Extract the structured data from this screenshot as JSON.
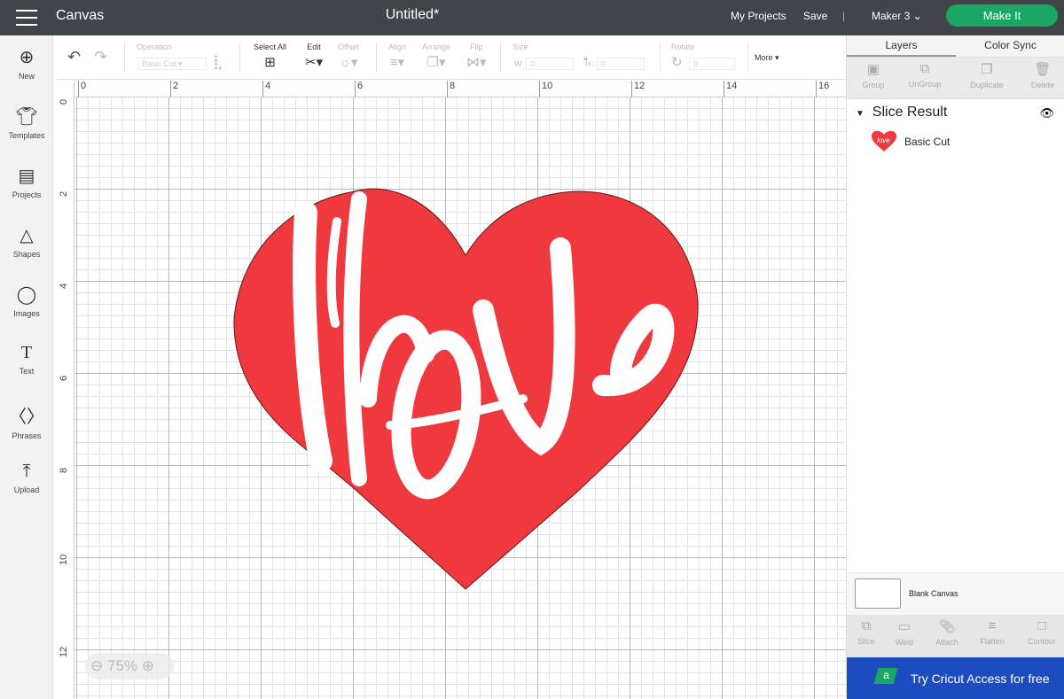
{
  "header": {
    "app_title": "Canvas",
    "doc_title": "Untitled*",
    "my_projects": "My Projects",
    "save": "Save",
    "machine": "Maker 3",
    "make_it": "Make It"
  },
  "leftbar": [
    {
      "label": "New",
      "icon": "plus-circle"
    },
    {
      "label": "Templates",
      "icon": "shirt"
    },
    {
      "label": "Projects",
      "icon": "clipboard"
    },
    {
      "label": "Shapes",
      "icon": "shapes"
    },
    {
      "label": "Images",
      "icon": "bulb"
    },
    {
      "label": "Text",
      "icon": "T"
    },
    {
      "label": "Phrases",
      "icon": "speech-bubble"
    },
    {
      "label": "Upload",
      "icon": "upload"
    }
  ],
  "toolbar": {
    "operation": "Operation",
    "operation_value": "Basic Cut",
    "select_all": "Select All",
    "edit": "Edit",
    "offset": "Offset",
    "align": "Align",
    "arrange": "Arrange",
    "flip": "Flip",
    "size": "Size",
    "w": "W",
    "w_value": "0",
    "h": "H",
    "h_value": "0",
    "rotate": "Rotate",
    "rotate_value": "0",
    "more": "More"
  },
  "ruler": {
    "h": [
      "0",
      "2",
      "4",
      "6",
      "8",
      "10",
      "12",
      "14",
      "16"
    ],
    "v": [
      "0",
      "2",
      "4",
      "6",
      "8",
      "10",
      "12"
    ]
  },
  "zoom": {
    "level": "75%"
  },
  "design": {
    "fill": "#f0393e",
    "text": "love"
  },
  "panel": {
    "tabs": [
      "Layers",
      "Color Sync"
    ],
    "actions": [
      "Group",
      "UnGroup",
      "Duplicate",
      "Delete"
    ],
    "group_name": "Slice Result",
    "layer_name": "Basic Cut",
    "blank_canvas": "Blank Canvas",
    "bottom_actions": [
      "Slice",
      "Weld",
      "Attach",
      "Flatten",
      "Contour"
    ],
    "promo": "Try Cricut Access for free",
    "promo_badge": "a"
  },
  "colors": {
    "topbar": "#414549",
    "make_it": "#1aa764",
    "promo": "#1d4bc0"
  }
}
